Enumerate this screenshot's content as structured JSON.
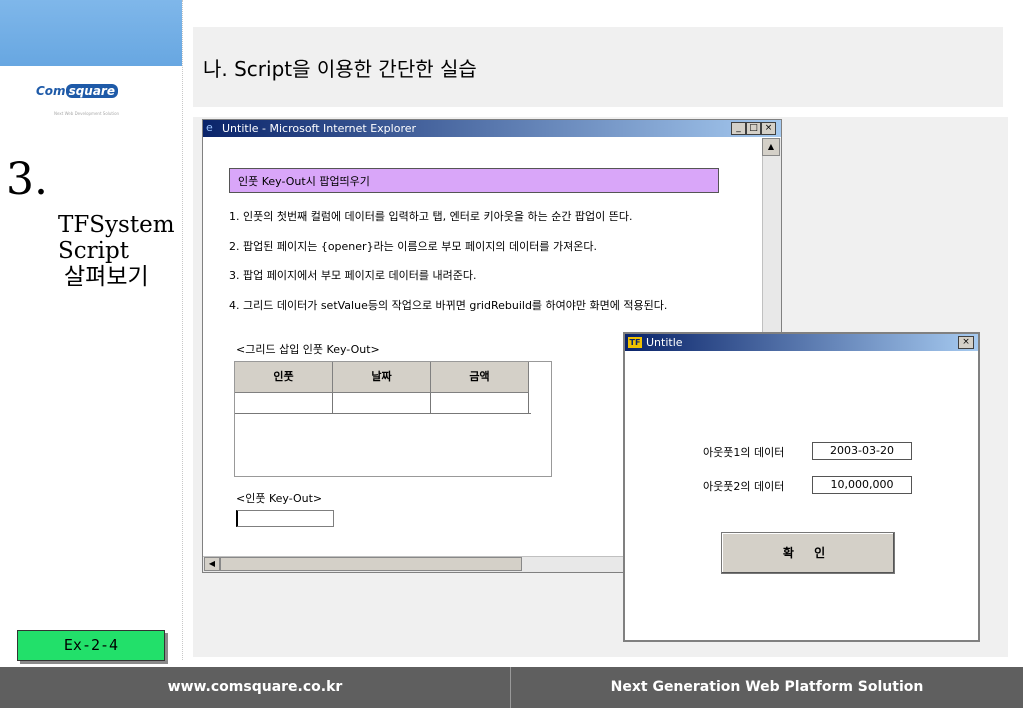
{
  "brand": {
    "logo_left": "Com",
    "logo_right": "square",
    "tagline": "Next Web Development Solution"
  },
  "section": {
    "number": "3.",
    "title_lines": [
      "TFSystem",
      "Script",
      "살펴보기"
    ]
  },
  "exercise": {
    "label": "Ex-2-4"
  },
  "header": {
    "title": "나. Script을 이용한 간단한 실습"
  },
  "ie_window": {
    "title": "Untitle - Microsoft Internet Explorer",
    "buttons": {
      "minimize": "_",
      "maximize": "□",
      "close": "×"
    },
    "banner": "인풋 Key-Out시 팝업띄우기",
    "instructions": [
      "1. 인풋의 첫번째 컬럼에 데이터를 입력하고 탭, 엔터로 키아웃을 하는 순간 팝업이 뜬다.",
      "2. 팝업된 페이지는 {opener}라는 이름으로 부모 페이지의 데이터를 가져온다.",
      "3. 팝업 페이지에서 부모 페이지로 데이터를 내려준다.",
      "4. 그리드 데이터가 setValue등의 작업으로 바뀌면 gridRebuild를 하여야만 화면에 적용된다."
    ],
    "grid": {
      "caption": "<그리드 삽입 인풋 Key-Out>",
      "columns": [
        "인풋",
        "날짜",
        "금액"
      ]
    },
    "input_caption": "<인풋 Key-Out>",
    "input_value": ""
  },
  "popup": {
    "title": "Untitle",
    "icon_text": "TF",
    "close": "×",
    "fields": [
      {
        "label": "아웃풋1의 데이터",
        "value": "2003-03-20"
      },
      {
        "label": "아웃풋2의 데이터",
        "value": "10,000,000"
      }
    ],
    "ok_label": "확 인"
  },
  "footer": {
    "left": "www.comsquare.co.kr",
    "right": "Next Generation Web Platform Solution"
  }
}
